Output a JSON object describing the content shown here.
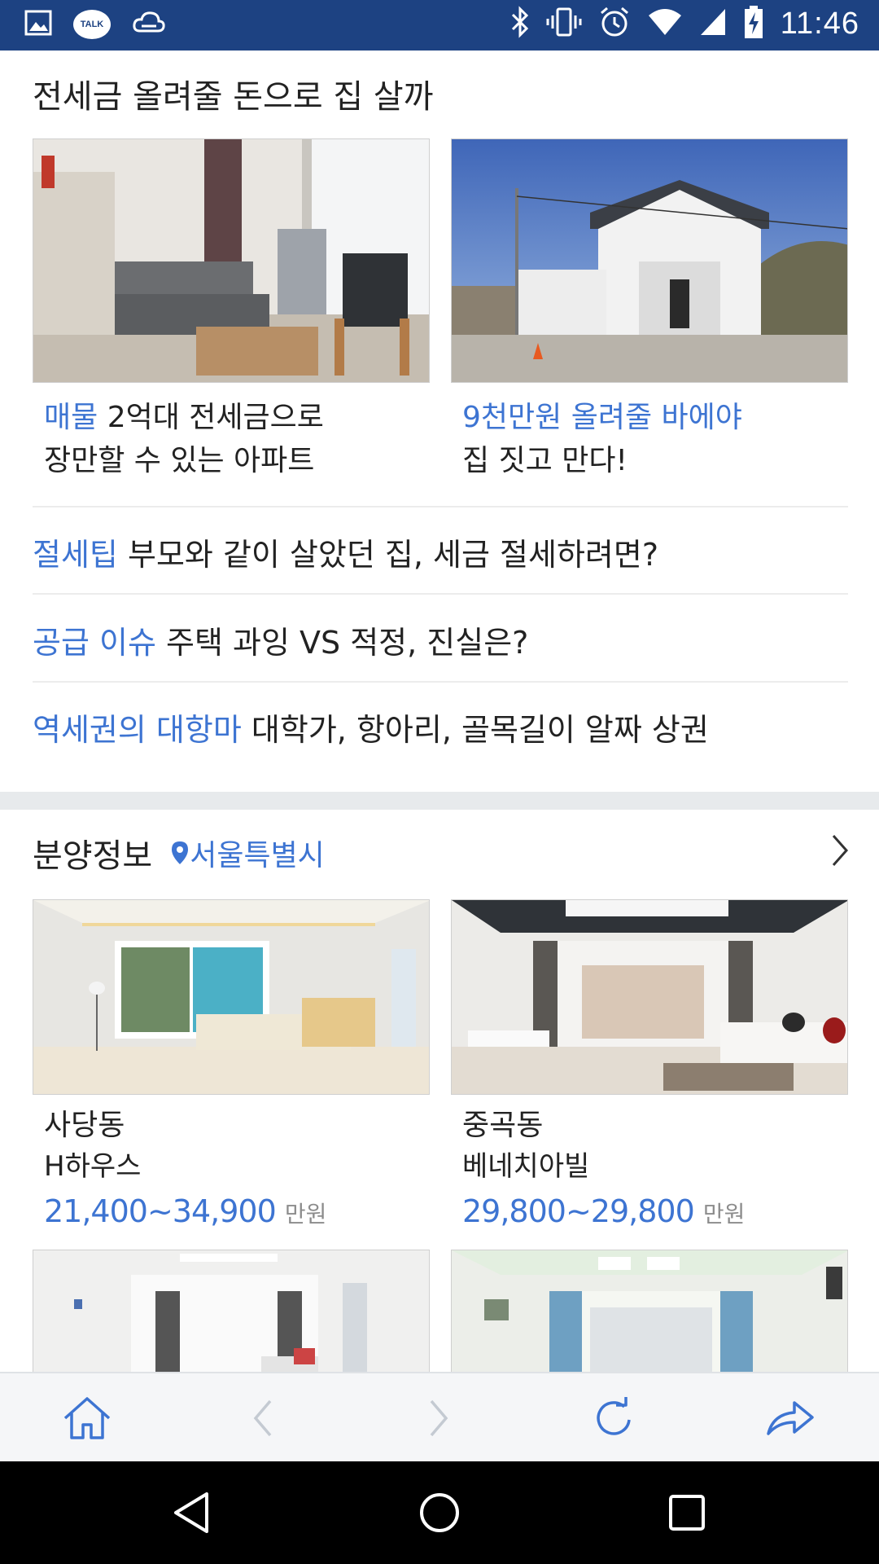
{
  "status_bar": {
    "time": "11:46",
    "left_icons": [
      "image-icon",
      "kakaotalk-icon",
      "cloud-icon"
    ],
    "talk_label": "TALK",
    "right_icons": [
      "bluetooth-icon",
      "vibrate-icon",
      "alarm-icon",
      "wifi-icon",
      "signal-icon",
      "battery-charging-icon"
    ]
  },
  "section1": {
    "title": "전세금 올려줄 돈으로 집 살까",
    "cards": [
      {
        "tag": "매물",
        "line1": "2억대 전세금으로",
        "line2": "장만할 수 있는 아파트",
        "image": "living-room-photo"
      },
      {
        "tag": "9천만원 올려줄 바에야",
        "line1": "",
        "line2": "집 짓고 만다!",
        "image": "white-house-photo"
      }
    ],
    "headlines": [
      {
        "tag": "절세팁",
        "text": "부모와 같이 살았던 집, 세금 절세하려면?"
      },
      {
        "tag": "공급 이슈",
        "text": "주택 과잉 VS 적정, 진실은?"
      },
      {
        "tag": "역세권의 대항마",
        "text": "대학가, 항아리, 골목길이 알짜 상권"
      }
    ]
  },
  "section2": {
    "title": "분양정보",
    "location": "서울특별시",
    "listings": [
      {
        "area": "사당동",
        "name": "H하우스",
        "price": "21,400~34,900",
        "unit": "만원"
      },
      {
        "area": "중곡동",
        "name": "베네치아빌",
        "price": "29,800~29,800",
        "unit": "만원"
      }
    ]
  },
  "toolbar": {
    "buttons": [
      "home-icon",
      "back-icon",
      "forward-icon",
      "refresh-icon",
      "share-icon"
    ]
  },
  "navbar": {
    "buttons": [
      "nav-back-icon",
      "nav-home-icon",
      "nav-recents-icon"
    ]
  },
  "colors": {
    "status_bar": "#1d4282",
    "accent_blue": "#3d74d2",
    "toolbar_bg": "#f5f6f8",
    "section_gap": "#e7eaec"
  }
}
